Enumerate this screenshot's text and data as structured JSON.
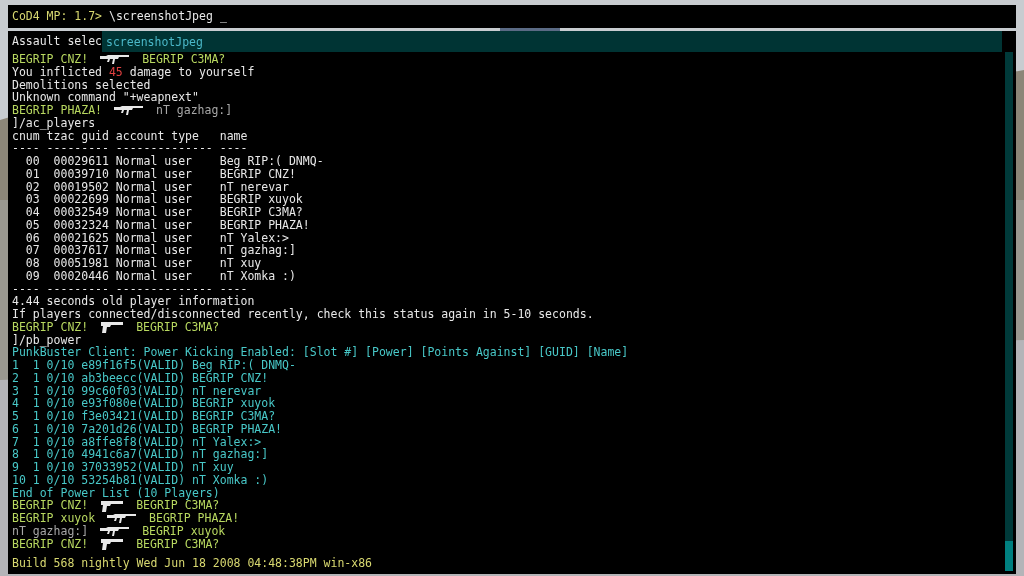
{
  "input": {
    "prompt": "CoD4 MP: 1.7>",
    "value": "\\screenshotJpeg",
    "cursor": "_"
  },
  "autocomplete": {
    "partial_line": "Assault selec",
    "suggestion": "screenshotJpeg"
  },
  "lines": [
    {
      "kind": "kill",
      "killer": {
        "name": "BEGRIP CNZ!",
        "color": "#b8d860"
      },
      "weapon": {
        "kind": "rifle"
      },
      "victim": {
        "name": "BEGRIP C3MA?",
        "color": "#b8d860"
      }
    },
    {
      "kind": "text",
      "parts": [
        {
          "text": "You inflicted ",
          "color": "#e8e8e8"
        },
        {
          "text": "45",
          "color": "#e04040"
        },
        {
          "text": " damage to yourself",
          "color": "#e8e8e8"
        }
      ]
    },
    {
      "kind": "text",
      "parts": [
        {
          "text": "Demolitions selected",
          "color": "#e8e8e8"
        }
      ]
    },
    {
      "kind": "text",
      "parts": [
        {
          "text": "Unknown command \"+weapnext\"",
          "color": "#e8e8e8"
        }
      ]
    },
    {
      "kind": "kill",
      "killer": {
        "name": "BEGRIP PHAZA!",
        "color": "#b8d860"
      },
      "weapon": {
        "kind": "rifle"
      },
      "victim": {
        "name": "nT gazhag:]",
        "color": "#a8a8a8"
      }
    },
    {
      "kind": "text",
      "parts": [
        {
          "text": "]/ac_players",
          "color": "#e8e8e8"
        }
      ]
    },
    {
      "kind": "text",
      "parts": [
        {
          "text": "cnum tzac guid account type   name",
          "color": "#e8e8e8"
        }
      ]
    },
    {
      "kind": "text",
      "parts": [
        {
          "text": "---- --------- -------------- ----",
          "color": "#e8e8e8"
        }
      ]
    },
    {
      "kind": "text",
      "parts": [
        {
          "text": "  00  00029611 Normal user    Beg RIP:( DNMQ-",
          "color": "#e8e8e8"
        }
      ]
    },
    {
      "kind": "text",
      "parts": [
        {
          "text": "  01  00039710 Normal user    BEGRIP CNZ!",
          "color": "#e8e8e8"
        }
      ]
    },
    {
      "kind": "text",
      "parts": [
        {
          "text": "  02  00019502 Normal user    nT nerevar",
          "color": "#e8e8e8"
        }
      ]
    },
    {
      "kind": "text",
      "parts": [
        {
          "text": "  03  00022699 Normal user    BEGRIP xuyok",
          "color": "#e8e8e8"
        }
      ]
    },
    {
      "kind": "text",
      "parts": [
        {
          "text": "  04  00032549 Normal user    BEGRIP C3MA?",
          "color": "#e8e8e8"
        }
      ]
    },
    {
      "kind": "text",
      "parts": [
        {
          "text": "  05  00032324 Normal user    BEGRIP PHAZA!",
          "color": "#e8e8e8"
        }
      ]
    },
    {
      "kind": "text",
      "parts": [
        {
          "text": "  06  00021625 Normal user    nT Yalex:>",
          "color": "#e8e8e8"
        }
      ]
    },
    {
      "kind": "text",
      "parts": [
        {
          "text": "  07  00037617 Normal user    nT gazhag:]",
          "color": "#e8e8e8"
        }
      ]
    },
    {
      "kind": "text",
      "parts": [
        {
          "text": "  08  00051981 Normal user    nT xuy",
          "color": "#e8e8e8"
        }
      ]
    },
    {
      "kind": "text",
      "parts": [
        {
          "text": "  09  00020446 Normal user    nT Xomka :)",
          "color": "#e8e8e8"
        }
      ]
    },
    {
      "kind": "text",
      "parts": [
        {
          "text": "---- --------- -------------- ----",
          "color": "#e8e8e8"
        }
      ]
    },
    {
      "kind": "text",
      "parts": [
        {
          "text": "4.44 seconds old player information",
          "color": "#e8e8e8"
        }
      ]
    },
    {
      "kind": "text",
      "parts": [
        {
          "text": "If players connected/disconnected recently, check this status again in 5-10 seconds.",
          "color": "#e8e8e8"
        }
      ]
    },
    {
      "kind": "kill",
      "killer": {
        "name": "BEGRIP CNZ!",
        "color": "#b8d860"
      },
      "weapon": {
        "kind": "pistol"
      },
      "victim": {
        "name": "BEGRIP C3MA?",
        "color": "#b8d860"
      }
    },
    {
      "kind": "text",
      "parts": [
        {
          "text": "]/pb_power",
          "color": "#e8e8e8"
        }
      ]
    },
    {
      "kind": "text",
      "parts": [
        {
          "text": "PunkBuster Client: Power Kicking Enabled: [Slot #] [Power] [Points Against] [GUID] [Name]",
          "color": "#48c8c8"
        }
      ]
    },
    {
      "kind": "text",
      "parts": [
        {
          "text": "1  1 0/10 e89f16f5(VALID) Beg RIP:( DNMQ-",
          "color": "#48c8c8"
        }
      ]
    },
    {
      "kind": "text",
      "parts": [
        {
          "text": "2  1 0/10 ab3beecc(VALID) BEGRIP CNZ!",
          "color": "#48c8c8"
        }
      ]
    },
    {
      "kind": "text",
      "parts": [
        {
          "text": "3  1 0/10 99c60f03(VALID) nT nerevar",
          "color": "#48c8c8"
        }
      ]
    },
    {
      "kind": "text",
      "parts": [
        {
          "text": "4  1 0/10 e93f080e(VALID) BEGRIP xuyok",
          "color": "#48c8c8"
        }
      ]
    },
    {
      "kind": "text",
      "parts": [
        {
          "text": "5  1 0/10 f3e03421(VALID) BEGRIP C3MA?",
          "color": "#48c8c8"
        }
      ]
    },
    {
      "kind": "text",
      "parts": [
        {
          "text": "6  1 0/10 7a201d26(VALID) BEGRIP PHAZA!",
          "color": "#48c8c8"
        }
      ]
    },
    {
      "kind": "text",
      "parts": [
        {
          "text": "7  1 0/10 a8ffe8f8(VALID) nT Yalex:>",
          "color": "#48c8c8"
        }
      ]
    },
    {
      "kind": "text",
      "parts": [
        {
          "text": "8  1 0/10 4941c6a7(VALID) nT gazhag:]",
          "color": "#48c8c8"
        }
      ]
    },
    {
      "kind": "text",
      "parts": [
        {
          "text": "9  1 0/10 37033952(VALID) nT xuy",
          "color": "#48c8c8"
        }
      ]
    },
    {
      "kind": "text",
      "parts": [
        {
          "text": "10 1 0/10 53254b81(VALID) nT Xomka :)",
          "color": "#48c8c8"
        }
      ]
    },
    {
      "kind": "text",
      "parts": [
        {
          "text": "End of Power List (10 Players)",
          "color": "#48c8c8"
        }
      ]
    },
    {
      "kind": "kill",
      "killer": {
        "name": "BEGRIP CNZ!",
        "color": "#b8d860"
      },
      "weapon": {
        "kind": "pistol"
      },
      "victim": {
        "name": "BEGRIP C3MA?",
        "color": "#b8d860"
      }
    },
    {
      "kind": "kill",
      "killer": {
        "name": "BEGRIP xuyok",
        "color": "#b8d860"
      },
      "weapon": {
        "kind": "rifle"
      },
      "victim": {
        "name": "BEGRIP PHAZA!",
        "color": "#b8d860"
      }
    },
    {
      "kind": "kill",
      "killer": {
        "name": "nT gazhag:]",
        "color": "#a8a8a8"
      },
      "weapon": {
        "kind": "rifle"
      },
      "victim": {
        "name": "BEGRIP xuyok",
        "color": "#b8d860"
      }
    },
    {
      "kind": "kill",
      "killer": {
        "name": "BEGRIP CNZ!",
        "color": "#b8d860"
      },
      "weapon": {
        "kind": "pistol"
      },
      "victim": {
        "name": "BEGRIP C3MA?",
        "color": "#b8d860"
      }
    }
  ],
  "build": "Build 568 nightly Wed Jun 18 2008 04:48:38PM win-x86"
}
